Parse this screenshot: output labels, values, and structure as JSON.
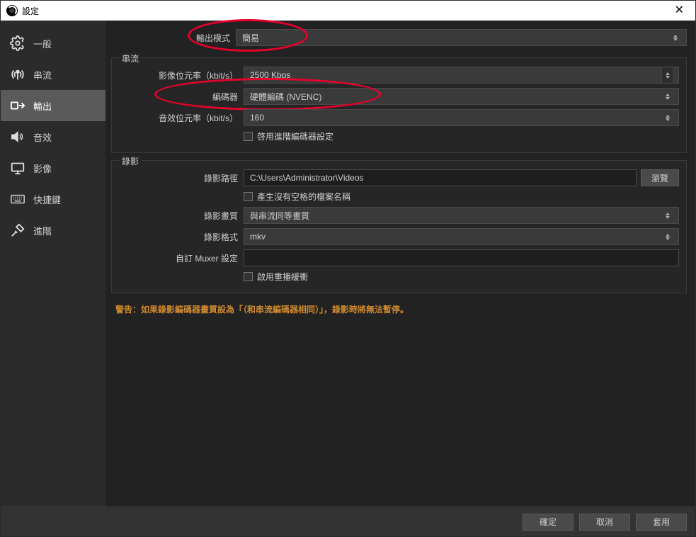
{
  "window": {
    "title": "設定"
  },
  "sidebar": {
    "items": [
      {
        "label": "一般"
      },
      {
        "label": "串流"
      },
      {
        "label": "輸出"
      },
      {
        "label": "音效"
      },
      {
        "label": "影像"
      },
      {
        "label": "快捷鍵"
      },
      {
        "label": "進階"
      }
    ]
  },
  "output_mode": {
    "label": "輸出模式",
    "value": "簡易"
  },
  "stream": {
    "section": "串流",
    "bitrate_label": "影像位元率（kbit/s）",
    "bitrate_value": "2500 Kbps",
    "encoder_label": "編碼器",
    "encoder_value": "硬體編碼 (NVENC)",
    "audio_bitrate_label": "音效位元率（kbit/s）",
    "audio_bitrate_value": "160",
    "advanced_checkbox": "啓用進階編碼器設定"
  },
  "record": {
    "section": "錄影",
    "path_label": "錄影路徑",
    "path_value": "C:\\Users\\Administrator\\Videos",
    "browse": "瀏覽",
    "nospace_checkbox": "產生沒有空格的檔案名稱",
    "quality_label": "錄影畫質",
    "quality_value": "與串流同等畫質",
    "format_label": "錄影格式",
    "format_value": "mkv",
    "muxer_label": "自訂 Muxer 設定",
    "muxer_value": "",
    "replay_checkbox": "啟用重播緩衝"
  },
  "warning_text": "警告：如果錄影編碼器畫質設為「（和串流編碼器相同）」，錄影時將無法暫停。",
  "footer": {
    "ok": "確定",
    "cancel": "取消",
    "apply": "套用"
  }
}
